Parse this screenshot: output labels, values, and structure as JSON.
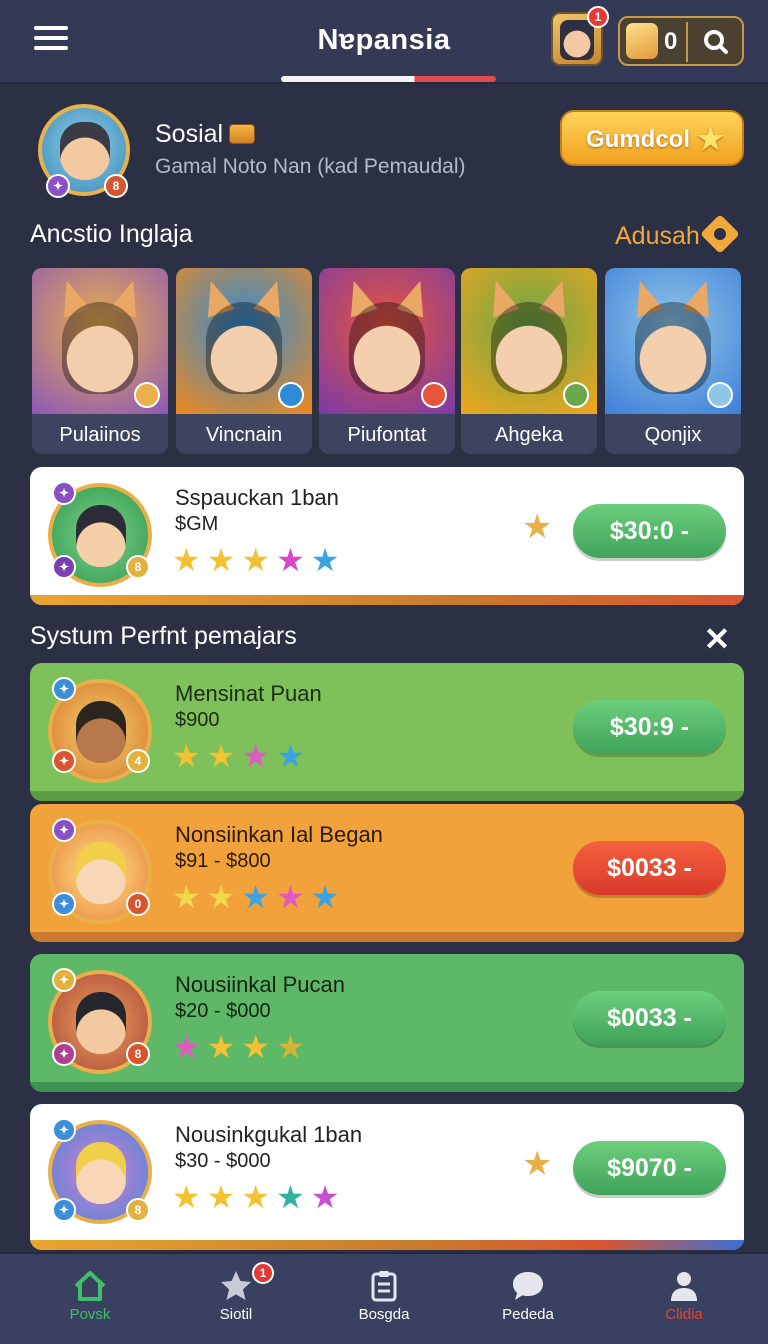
{
  "header": {
    "title": "Nɐpansia",
    "notification_count": "1",
    "coin_count": "0"
  },
  "profile": {
    "name": "Sosial",
    "subtitle": "Gamal Noto Nan (kad Pemaudal)",
    "level_badge": "8",
    "action_button": "Gumdcol"
  },
  "section_characters": {
    "title": "Ancstio Inglaja",
    "link": "Adusah",
    "characters": [
      {
        "name": "Pulaiinos",
        "colors": [
          "#8d57b8",
          "#e9b04b"
        ]
      },
      {
        "name": "Vincnain",
        "colors": [
          "#f08a1c",
          "#2f8bd6"
        ]
      },
      {
        "name": "Piufontat",
        "colors": [
          "#7a3aa8",
          "#e8553a"
        ]
      },
      {
        "name": "Ahgeka",
        "colors": [
          "#f3a51b",
          "#69a84a"
        ]
      },
      {
        "name": "Qonjix",
        "colors": [
          "#3f7fd8",
          "#8ec6e8"
        ]
      }
    ]
  },
  "featured_offer": {
    "title": "Sspauckan 1ban",
    "price": "$GM",
    "stars": "★★★★★",
    "buy": "$30:0 -",
    "badge": "8"
  },
  "section_offers": {
    "title": "Systum Perfnt pemajars"
  },
  "offers": [
    {
      "title": "Mensinat Puan",
      "price": "$900",
      "stars": "★★★★",
      "buy": "$30:9 -",
      "badge": "4"
    },
    {
      "title": "Nonsiinkan Ial Began",
      "price": "$91 - $800",
      "stars": "★★★★★",
      "buy": "$0033 -",
      "badge": "0"
    },
    {
      "title": "Nousiinkal Pucan",
      "price": "$20 - $000",
      "stars": "★★★★",
      "buy": "$0033 -",
      "badge": "8"
    },
    {
      "title": "Nousinkgukal 1ban",
      "price": "$30 - $000",
      "stars": "★★★★★",
      "buy": "$9070 -",
      "badge": "8"
    }
  ],
  "nav": [
    {
      "label": "Povsk",
      "icon": "home-icon"
    },
    {
      "label": "Siotil",
      "icon": "star-icon",
      "badge": "1"
    },
    {
      "label": "Bosgda",
      "icon": "clipboard-icon"
    },
    {
      "label": "Pededa",
      "icon": "chat-icon"
    },
    {
      "label": "Clidia",
      "icon": "profile-icon"
    }
  ],
  "colors": {
    "background": "#2b3045",
    "accent_gold": "#f0a21f",
    "buy_green": "#3fa35a",
    "buy_red": "#d83a2a",
    "nav_active": "#3fbf6a",
    "nav_profile": "#e0453a"
  }
}
